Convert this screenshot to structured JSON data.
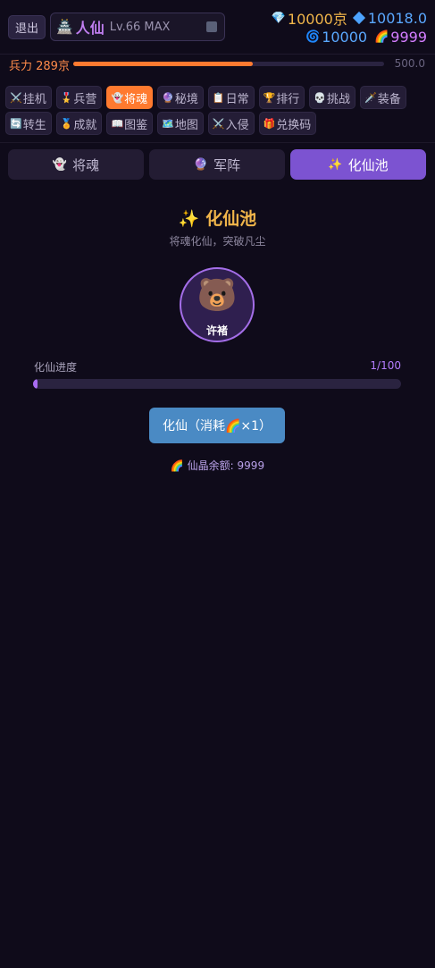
{
  "header": {
    "logout_label": "退出",
    "rank_icon": "🏯",
    "rank_name": "人仙",
    "rank_level": "Lv.66 MAX",
    "resources": {
      "gem": {
        "icon": "💎",
        "value": "10000京"
      },
      "diamond": {
        "icon": "diamond",
        "value": "10018.0"
      },
      "spiral": {
        "icon": "🌀",
        "value": "10000"
      },
      "rainbow": {
        "icon": "🌈",
        "value": "9999"
      }
    }
  },
  "power": {
    "label": "兵力 289京",
    "max": "500.0",
    "fraction": 0.578
  },
  "nav": {
    "row1": [
      {
        "icon": "⚔️",
        "label": "挂机"
      },
      {
        "icon": "🎖️",
        "label": "兵营"
      },
      {
        "icon": "👻",
        "label": "将魂"
      },
      {
        "icon": "🔮",
        "label": "秘境"
      },
      {
        "icon": "📋",
        "label": "日常"
      },
      {
        "icon": "🏆",
        "label": "排行"
      },
      {
        "icon": "💀",
        "label": "挑战"
      },
      {
        "icon": "🗡️",
        "label": "装备"
      }
    ],
    "row2": [
      {
        "icon": "🔄",
        "label": "转生"
      },
      {
        "icon": "🏅",
        "label": "成就"
      },
      {
        "icon": "📖",
        "label": "图鉴"
      },
      {
        "icon": "🗺️",
        "label": "地图"
      },
      {
        "icon": "⚔️",
        "label": "入侵"
      },
      {
        "icon": "🎁",
        "label": "兑换码"
      }
    ]
  },
  "subtabs": [
    {
      "icon": "👻",
      "label": "将魂"
    },
    {
      "icon": "🔮",
      "label": "军阵"
    },
    {
      "icon": "✨",
      "label": "化仙池"
    }
  ],
  "pool": {
    "title": "✨ 化仙池",
    "subtitle": "将魂化仙，突破凡尘",
    "avatar_emoji": "🐻",
    "avatar_name": "许褚",
    "progress_label": "化仙进度",
    "progress_count": "1/100",
    "progress_fraction": 0.01,
    "button_label": "化仙（消耗🌈×1）",
    "balance_label": "🌈 仙晶余额: 9999"
  },
  "colors": {
    "accent_orange": "#ff7a2f",
    "accent_purple": "#7c53d1",
    "gold": "#f0b54a",
    "button_blue": "#4a8ac4"
  }
}
